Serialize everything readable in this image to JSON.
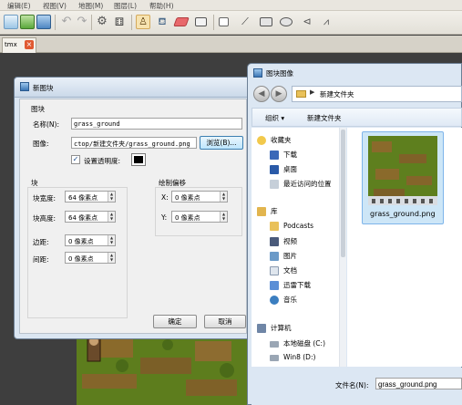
{
  "menubar": {
    "items": [
      "编辑(E)",
      "视图(V)",
      "地图(M)",
      "图层(L)",
      "帮助(H)"
    ]
  },
  "toolbar": {
    "icons": [
      "new-file-icon",
      "open-file-icon",
      "save-icon",
      "undo-icon",
      "redo-icon",
      "settings-icon",
      "random-dice-icon",
      "stamp-brush-icon",
      "bucket-fill-icon",
      "eraser-icon",
      "rect-select-icon",
      "object-select-icon",
      "node-edit-icon",
      "rect-object-icon",
      "ellipse-object-icon",
      "polygon-icon",
      "polyline-icon"
    ]
  },
  "tabs": [
    {
      "label": "tmx",
      "close": "×"
    }
  ],
  "new_tileset_dialog": {
    "title": "新图块",
    "section_tileset": "图块",
    "name_label": "名称(N):",
    "name_value": "grass_ground",
    "image_label": "图像:",
    "image_value": "ctop/新建文件夹/grass_ground.png",
    "browse_button": "浏览(B)...",
    "transparency_checkbox": {
      "label": "设置透明度:",
      "checked": true,
      "color": "#000000"
    },
    "section_tile": "块",
    "width_label": "块宽度:",
    "width_value": "64 像素点",
    "height_label": "块高度:",
    "height_value": "64 像素点",
    "margin_label": "边距:",
    "margin_value": "0 像素点",
    "spacing_label": "间距:",
    "spacing_value": "0 像素点",
    "section_offset": "绘制偏移",
    "x_label": "X:",
    "x_value": "0 像素点",
    "y_label": "Y:",
    "y_value": "0 像素点",
    "ok_button": "确定",
    "cancel_button": "取消"
  },
  "file_dialog": {
    "title": "图块图像",
    "breadcrumb": "新建文件夹",
    "organize_button": "组织",
    "new_folder_button": "新建文件夹",
    "nav_items": [
      {
        "label": "收藏夹",
        "icon": "star-icon"
      },
      {
        "label": "下载",
        "icon": "download-folder-icon"
      },
      {
        "label": "桌面",
        "icon": "desktop-icon"
      },
      {
        "label": "最近访问的位置",
        "icon": "recent-places-icon"
      },
      {
        "label": "库",
        "icon": "library-icon"
      },
      {
        "label": "Podcasts",
        "icon": "folder-icon"
      },
      {
        "label": "视频",
        "icon": "video-icon"
      },
      {
        "label": "图片",
        "icon": "pictures-icon"
      },
      {
        "label": "文档",
        "icon": "documents-icon"
      },
      {
        "label": "迅雷下载",
        "icon": "thunder-download-icon"
      },
      {
        "label": "音乐",
        "icon": "music-icon"
      },
      {
        "label": "计算机",
        "icon": "computer-icon"
      },
      {
        "label": "本地磁盘 (C:)",
        "icon": "drive-icon"
      },
      {
        "label": "Win8 (D:)",
        "icon": "drive-icon"
      }
    ],
    "file_item": {
      "label": "grass_ground.png"
    },
    "filename_label": "文件名(N):",
    "filename_value": "grass_ground.png"
  }
}
